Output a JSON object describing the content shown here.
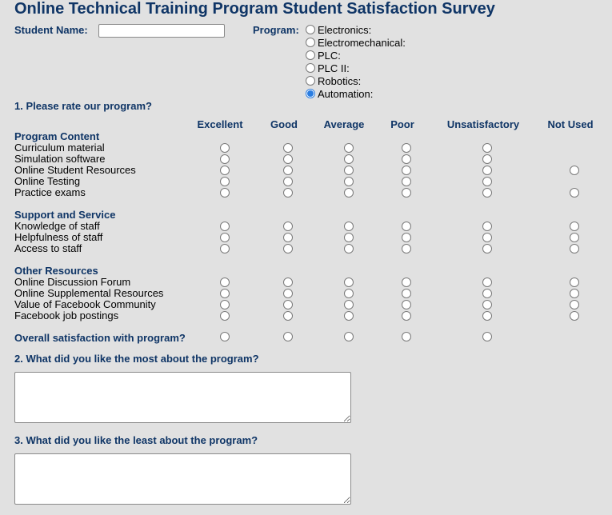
{
  "title": "Online Technical Training Program Student Satisfaction Survey",
  "student_name": {
    "label": "Student Name:",
    "value": ""
  },
  "program": {
    "label": "Program:",
    "options": [
      {
        "label": "Electronics:",
        "checked": false
      },
      {
        "label": "Electromechanical:",
        "checked": false
      },
      {
        "label": "PLC:",
        "checked": false
      },
      {
        "label": "PLC II:",
        "checked": false
      },
      {
        "label": "Robotics:",
        "checked": false
      },
      {
        "label": "Automation:",
        "checked": true
      }
    ]
  },
  "q1": {
    "label": "1. Please rate our program?",
    "columns": [
      "Excellent",
      "Good",
      "Average",
      "Poor",
      "Unsatisfactory",
      "Not Used"
    ],
    "sections": [
      {
        "title": "Program Content",
        "rows": [
          {
            "label": "Curriculum material",
            "not_used": false
          },
          {
            "label": "Simulation software",
            "not_used": false
          },
          {
            "label": "Online Student Resources",
            "not_used": true
          },
          {
            "label": "Online Testing",
            "not_used": false
          },
          {
            "label": "Practice exams",
            "not_used": true
          }
        ]
      },
      {
        "title": "Support and Service",
        "rows": [
          {
            "label": "Knowledge of staff",
            "not_used": true
          },
          {
            "label": "Helpfulness of staff",
            "not_used": true
          },
          {
            "label": "Access to staff",
            "not_used": true
          }
        ]
      },
      {
        "title": "Other Resources",
        "rows": [
          {
            "label": "Online Discussion Forum",
            "not_used": true
          },
          {
            "label": "Online Supplemental Resources",
            "not_used": true
          },
          {
            "label": "Value of Facebook Community",
            "not_used": true
          },
          {
            "label": "Facebook job postings",
            "not_used": true
          }
        ]
      }
    ],
    "overall": {
      "label": "Overall satisfaction with program?",
      "not_used": false
    }
  },
  "q2": {
    "label": "2. What did you like the most about the program?",
    "value": ""
  },
  "q3": {
    "label": "3. What did you like the least about the program?",
    "value": ""
  },
  "colors": {
    "heading": "#0f3566",
    "background": "#e1e1e1",
    "radio_checked": "#2a7de1"
  }
}
